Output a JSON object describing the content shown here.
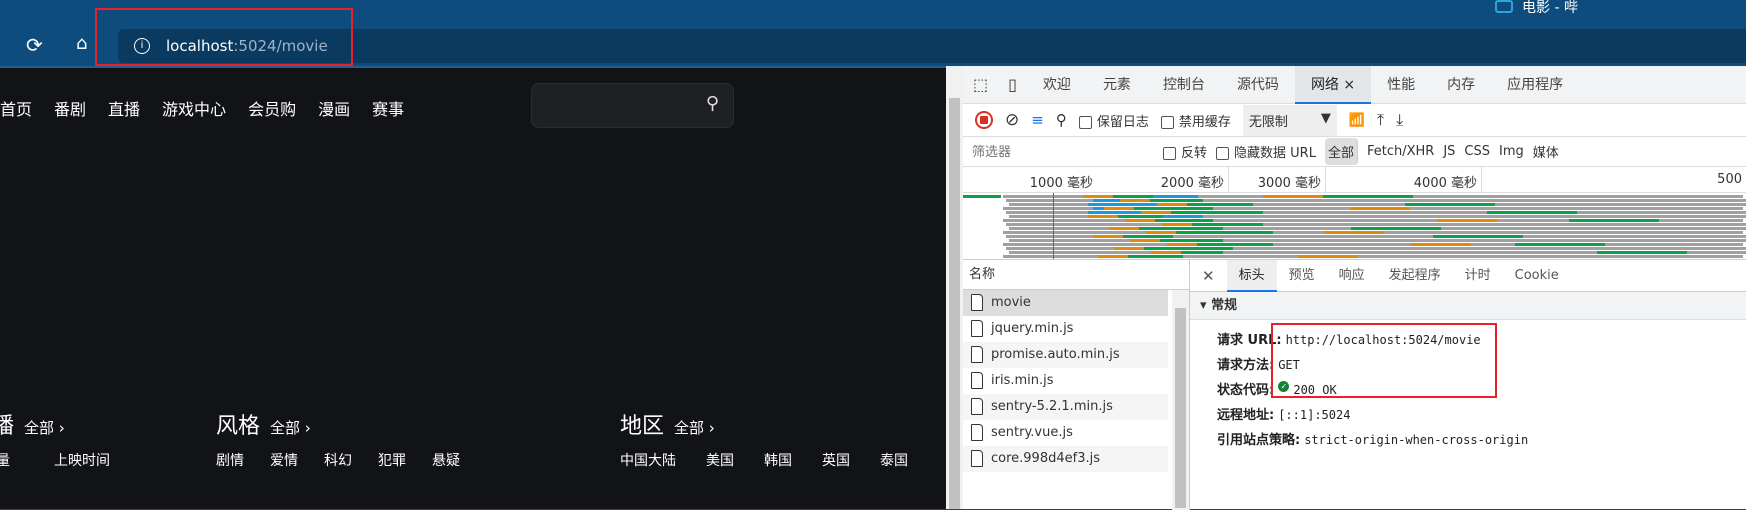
{
  "browser": {
    "window_title": "电影 - 哔",
    "address_host": "localhost",
    "address_rest": ":5024/movie"
  },
  "page": {
    "nav": [
      "首页",
      "番剧",
      "直播",
      "游戏中心",
      "会员购",
      "漫画",
      "赛事"
    ],
    "sections": [
      {
        "title": "播",
        "all": "全部 ›",
        "items": [
          "量",
          "上映时间"
        ]
      },
      {
        "title": "风格",
        "all": "全部 ›",
        "items": [
          "剧情",
          "爱情",
          "科幻",
          "犯罪",
          "悬疑"
        ]
      },
      {
        "title": "地区",
        "all": "全部 ›",
        "items": [
          "中国大陆",
          "美国",
          "韩国",
          "英国",
          "泰国"
        ]
      }
    ]
  },
  "devtools": {
    "tabs": [
      "欢迎",
      "元素",
      "控制台",
      "源代码",
      "网络",
      "性能",
      "内存",
      "应用程序"
    ],
    "active_tab": "网络",
    "toolbar": {
      "preserve_log": "保留日志",
      "disable_cache": "禁用缓存",
      "throttle": "无限制"
    },
    "filter": {
      "placeholder": "筛选器",
      "invert": "反转",
      "hide_data_urls": "隐藏数据 URL",
      "types": [
        "全部",
        "Fetch/XHR",
        "JS",
        "CSS",
        "Img",
        "媒体"
      ]
    },
    "ruler": [
      "1000 毫秒",
      "2000 毫秒",
      "3000 毫秒",
      "4000 毫秒",
      "500"
    ],
    "name_header": "名称",
    "files": [
      "movie",
      "jquery.min.js",
      "promise.auto.min.js",
      "iris.min.js",
      "sentry-5.2.1.min.js",
      "sentry.vue.js",
      "core.998d4ef3.js"
    ],
    "detail_tabs": [
      "标头",
      "预览",
      "响应",
      "发起程序",
      "计时",
      "Cookie"
    ],
    "general": {
      "title": "常规",
      "rows": [
        {
          "k": "请求 URL:",
          "v": "http://localhost:5024/movie"
        },
        {
          "k": "请求方法:",
          "v": "GET"
        },
        {
          "k": "状态代码:",
          "v": "200 OK"
        },
        {
          "k": "远程地址:",
          "v": "[::1]:5024"
        },
        {
          "k": "引用站点策略:",
          "v": "strict-origin-when-cross-origin"
        }
      ]
    }
  },
  "colors": {
    "accent": "#1a73e8",
    "highlight": "#e8202a",
    "ok": "#188038"
  }
}
